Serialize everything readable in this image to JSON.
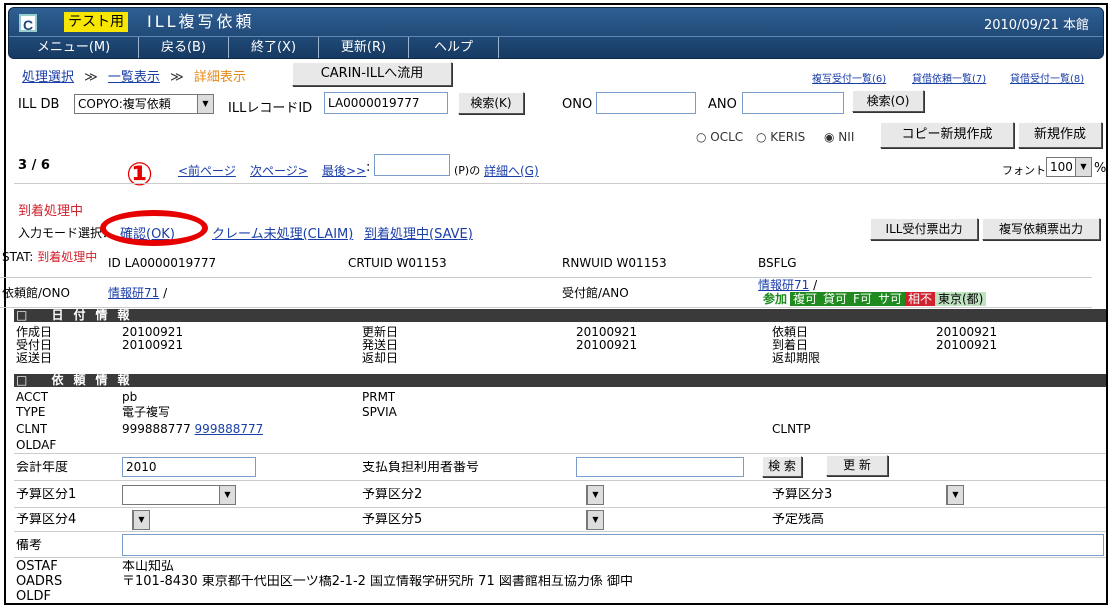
{
  "window": {
    "test_label": "テスト用",
    "title": "ILL複写依頼",
    "date": "2010/09/21 本館"
  },
  "menu": [
    "メニュー(M)",
    "戻る(B)",
    "終了(X)",
    "更新(R)",
    "ヘルプ"
  ],
  "breadcrumb": {
    "item1": "処理選択",
    "item2": "一覧表示",
    "item3": "詳細表示",
    "sep": "≫"
  },
  "carin_button": "CARIN-ILLへ流用",
  "top_links": [
    "複写受付一覧(6)",
    "貸借依頼一覧(7)",
    "貸借受付一覧(8)"
  ],
  "search": {
    "illdb_label": "ILL DB",
    "illdb_value": "COPYO:複写依頼",
    "record_label": "ILLレコードID",
    "record_value": "LA0000019777",
    "search_k": "検索(K)",
    "ono_label": "ONO",
    "ano_label": "ANO",
    "search_o": "検索(O)"
  },
  "radios": [
    "OCLC",
    "KERIS",
    "NII"
  ],
  "buttons": {
    "copy_new": "コピー新規作成",
    "new": "新規作成"
  },
  "paging": {
    "position": "3 / 6",
    "prev": "<前ページ",
    "next": "次ページ>",
    "last": "最後>>",
    "colon": ":",
    "p_suffix": "(P)の",
    "detail": "詳細へ(G)",
    "font_label": "フォント",
    "font_value": "100",
    "percent": "%"
  },
  "annotation": "①",
  "status_heading": "到着処理中",
  "mode": {
    "label": "入力モード選択：",
    "ok": "確認(OK)",
    "claim": "クレーム未処理(CLAIM)",
    "save": "到着処理中(SAVE)"
  },
  "print_buttons": [
    "ILL受付票出力",
    "複写依頼票出力"
  ],
  "info": {
    "stat_label": "STAT:",
    "stat_value": "到着処理中",
    "id": "ID  LA0000019777",
    "crtuid": "CRTUID  W01153",
    "rnwuid": "RNWUID  W01153",
    "bsflg": "BSFLG",
    "irai_label": "依頼館/ONO",
    "irai_link": "情報研71",
    "slash": "/",
    "uketsuke_label": "受付館/ANO",
    "uke_link": "情報研71",
    "uke_slash": "/",
    "badges": [
      {
        "text": "参加",
        "color": "#1f8a1f"
      },
      {
        "text": "複可",
        "color": "#1f8a1f"
      },
      {
        "text": "貸可",
        "color": "#1f8a1f"
      },
      {
        "text": "F可",
        "color": "#1f8a1f"
      },
      {
        "text": "サ可",
        "color": "#1f8a1f"
      },
      {
        "text": "相不",
        "color": "#d0212c"
      },
      {
        "text": "東京(都)",
        "color": "#bfe3c0"
      }
    ]
  },
  "date_section": "日付情報",
  "dates": {
    "sakusei": "作成日",
    "sakusei_v": "20100921",
    "koushin": "更新日",
    "koushin_v": "20100921",
    "irai": "依頼日",
    "irai_v": "20100921",
    "uketsuke": "受付日",
    "uketsuke_v": "20100921",
    "hassou": "発送日",
    "hassou_v": "20100921",
    "chaku": "到着日",
    "chaku_v": "20100921",
    "hensou": "返送日",
    "henkyaku": "返却日",
    "kigen": "返却期限"
  },
  "req_section": "依頼情報",
  "req": {
    "acct": "ACCT",
    "acct_v": "pb",
    "prmt": "PRMT",
    "type": "TYPE",
    "type_v": "電子複写",
    "spvia": "SPVIA",
    "clnt": "CLNT",
    "clnt_v": "999888777",
    "clnt_link": "999888777",
    "clntp": "CLNTP",
    "oldaf": "OLDAF"
  },
  "kaikei": {
    "label": "会計年度",
    "value": "2010",
    "shiharai": "支払負担利用者番号",
    "search": "検 索",
    "update": "更 新"
  },
  "yosan": [
    "予算区分1",
    "予算区分2",
    "予算区分3",
    "予算区分4",
    "予算区分5"
  ],
  "yotei": "予定残高",
  "bikou": "備考",
  "ostaf": {
    "label": "OSTAF",
    "value": "本山知弘"
  },
  "oadrs": {
    "label": "OADRS",
    "value": "〒101-8430 東京都千代田区一ツ橋2-1-2 国立情報学研究所 71 図書館相互協力係 御中"
  },
  "oldf": "OLDF"
}
